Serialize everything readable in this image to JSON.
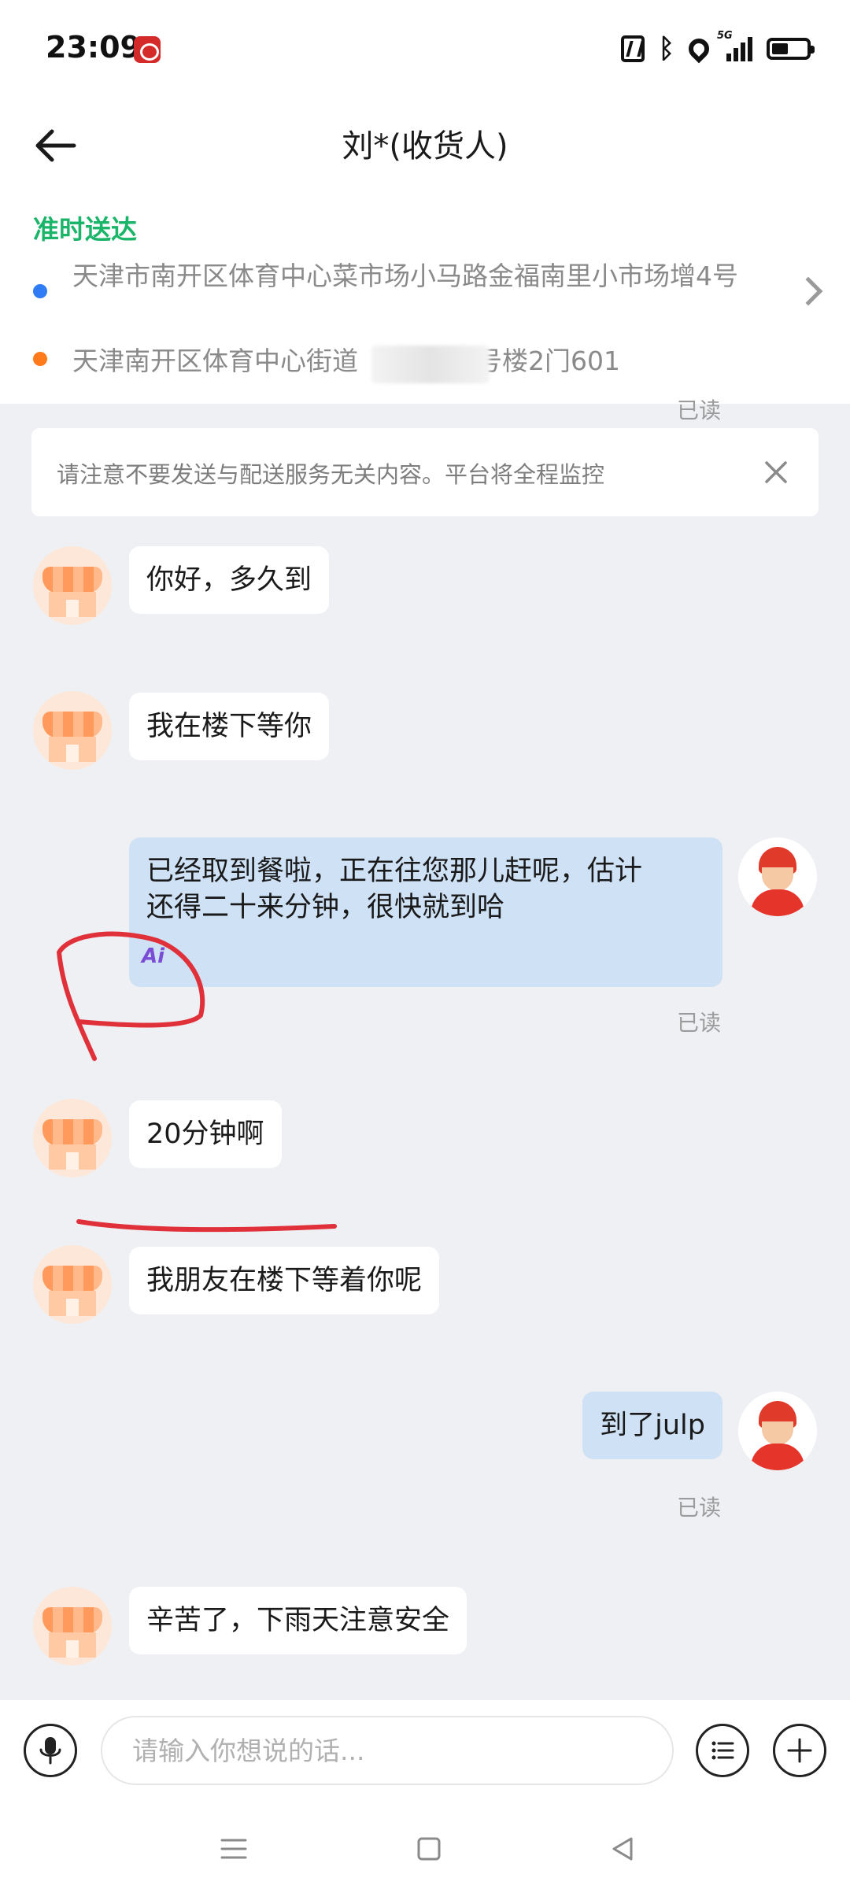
{
  "status_bar": {
    "time": "23:09",
    "network": "5G",
    "icons": [
      "app-notification-icon",
      "nfc-icon",
      "bluetooth-icon",
      "location-icon",
      "signal-icon",
      "battery-icon"
    ]
  },
  "header": {
    "title": "刘*(收货人)",
    "back_icon": "back-arrow-icon"
  },
  "order": {
    "status": "准时送达",
    "pickup_address": "天津市南开区体育中心菜市场小马路金福南里小市场增4号",
    "delivery_address_start": "天津南开区体育中心街道",
    "delivery_address_end": "号楼2门601",
    "pickup_dot_color": "#2f7cf6",
    "delivery_dot_color": "#ff7a1a",
    "status_color": "#1bb56a"
  },
  "notice": {
    "text": "请注意不要发送与配送服务无关内容。平台将全程监控",
    "close_icon": "close-icon"
  },
  "messages": [
    {
      "from": "customer",
      "text": "你好，多久到"
    },
    {
      "from": "customer",
      "text": "我在楼下等你"
    },
    {
      "from": "rider",
      "line1": "已经取到餐啦，正在往您那儿赶呢，估计",
      "line2": "还得二十来分钟，很快就到哈",
      "badge": "Ai",
      "read": "已读"
    },
    {
      "from": "customer",
      "text": "20分钟啊"
    },
    {
      "from": "customer",
      "text": "我朋友在楼下等着你呢"
    },
    {
      "from": "rider",
      "text": "到了julp",
      "read": "已读"
    },
    {
      "from": "customer",
      "text": "辛苦了，下雨天注意安全"
    }
  ],
  "partial_read": "已读",
  "input": {
    "placeholder": "请输入你想说的话..."
  },
  "colors": {
    "accent": "#1bb56a",
    "outgoing_bubble": "#cfe1f5",
    "background": "#eff0f4",
    "annotation_red": "#e0303a"
  }
}
